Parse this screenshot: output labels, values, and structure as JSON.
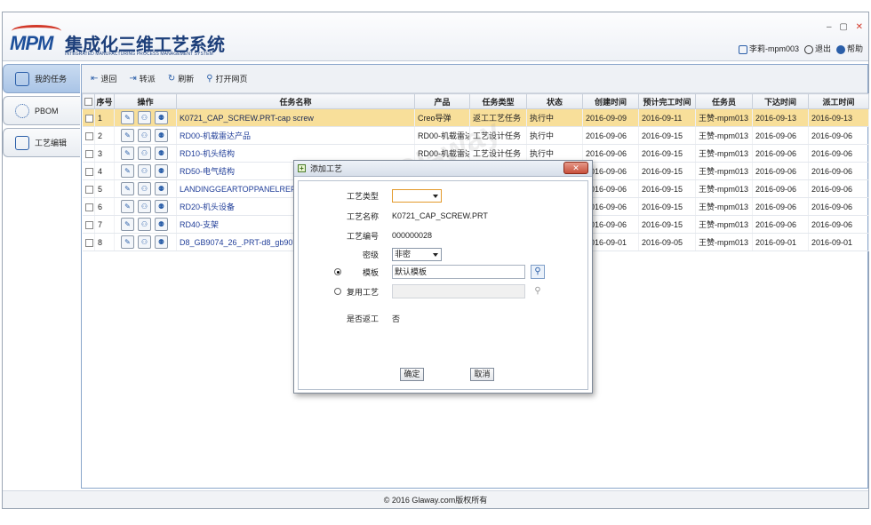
{
  "app": {
    "logo_text": "MPM",
    "title": "集成化三维工艺系统",
    "subtitle": "INTEGRATED MANUFACTURING PROCESS MANAGEMENT SYSTEM",
    "window_controls": [
      "–",
      "▢",
      "✕"
    ],
    "user": "李莉-mpm003",
    "logout": "退出",
    "help": "帮助"
  },
  "sidebar": {
    "items": [
      {
        "label": "我的任务",
        "icon": "task-edit-icon"
      },
      {
        "label": "PBOM",
        "icon": "gear-icon"
      },
      {
        "label": "工艺编辑",
        "icon": "process-edit-icon"
      }
    ]
  },
  "toolbar": {
    "back": "退回",
    "forward": "转派",
    "refresh": "刷新",
    "open_web": "打开网页"
  },
  "table": {
    "headers": [
      "",
      "序号",
      "操作",
      "任务名称",
      "产品",
      "任务类型",
      "状态",
      "创建时间",
      "预计完工时间",
      "任务员",
      "下达时间",
      "派工时间"
    ],
    "rows": [
      {
        "no": "1",
        "name": "K0721_CAP_SCREW.PRT-cap screw",
        "product": "Creo导弹",
        "type": "返工工艺任务",
        "status": "执行中",
        "created": "2016-09-09",
        "due": "2016-09-11",
        "staff": "王赞-mpm013",
        "issued": "2016-09-13",
        "dispatched": "2016-09-13"
      },
      {
        "no": "2",
        "name": "RD00-机载雷达产品",
        "product": "RD00-机载雷达",
        "type": "工艺设计任务",
        "status": "执行中",
        "created": "2016-09-06",
        "due": "2016-09-15",
        "staff": "王赞-mpm013",
        "issued": "2016-09-06",
        "dispatched": "2016-09-06"
      },
      {
        "no": "3",
        "name": "RD10-机头结构",
        "product": "RD00-机载雷达",
        "type": "工艺设计任务",
        "status": "执行中",
        "created": "2016-09-06",
        "due": "2016-09-15",
        "staff": "王赞-mpm013",
        "issued": "2016-09-06",
        "dispatched": "2016-09-06"
      },
      {
        "no": "4",
        "name": "RD50-电气结构",
        "product": "",
        "type": "",
        "status": "",
        "created": "2016-09-06",
        "due": "2016-09-15",
        "staff": "王赞-mpm013",
        "issued": "2016-09-06",
        "dispatched": "2016-09-06"
      },
      {
        "no": "5",
        "name": "LANDINGGEARTOPPANELREF10",
        "product": "",
        "type": "",
        "status": "",
        "created": "2016-09-06",
        "due": "2016-09-15",
        "staff": "王赞-mpm013",
        "issued": "2016-09-06",
        "dispatched": "2016-09-06"
      },
      {
        "no": "6",
        "name": "RD20-机头设备",
        "product": "",
        "type": "",
        "status": "",
        "created": "2016-09-06",
        "due": "2016-09-15",
        "staff": "王赞-mpm013",
        "issued": "2016-09-06",
        "dispatched": "2016-09-06"
      },
      {
        "no": "7",
        "name": "RD40-支架",
        "product": "",
        "type": "",
        "status": "",
        "created": "2016-09-06",
        "due": "2016-09-15",
        "staff": "王赞-mpm013",
        "issued": "2016-09-06",
        "dispatched": "2016-09-06"
      },
      {
        "no": "8",
        "name": "D8_GB9074_26_.PRT-d8_gb9074",
        "product": "",
        "type": "",
        "status": "",
        "created": "2016-09-01",
        "due": "2016-09-05",
        "staff": "王赞-mpm013",
        "issued": "2016-09-01",
        "dispatched": "2016-09-01"
      }
    ]
  },
  "dialog": {
    "title": "添加工艺",
    "close": "✕",
    "type_label": "工艺类型",
    "type_value": "",
    "name_label": "工艺名称",
    "name_value": "K0721_CAP_SCREW.PRT",
    "code_label": "工艺编号",
    "code_value": "000000028",
    "secret_label": "密级",
    "secret_value": "非密",
    "template_label": "模板",
    "template_value": "默认模板",
    "reuse_label": "复用工艺",
    "reuse_value": "",
    "rework_label": "是否返工",
    "rework_value": "否",
    "ok": "确定",
    "cancel": "取消"
  },
  "footer": "© 2016 Glaway.com版权所有",
  "watermark": "Glaway"
}
